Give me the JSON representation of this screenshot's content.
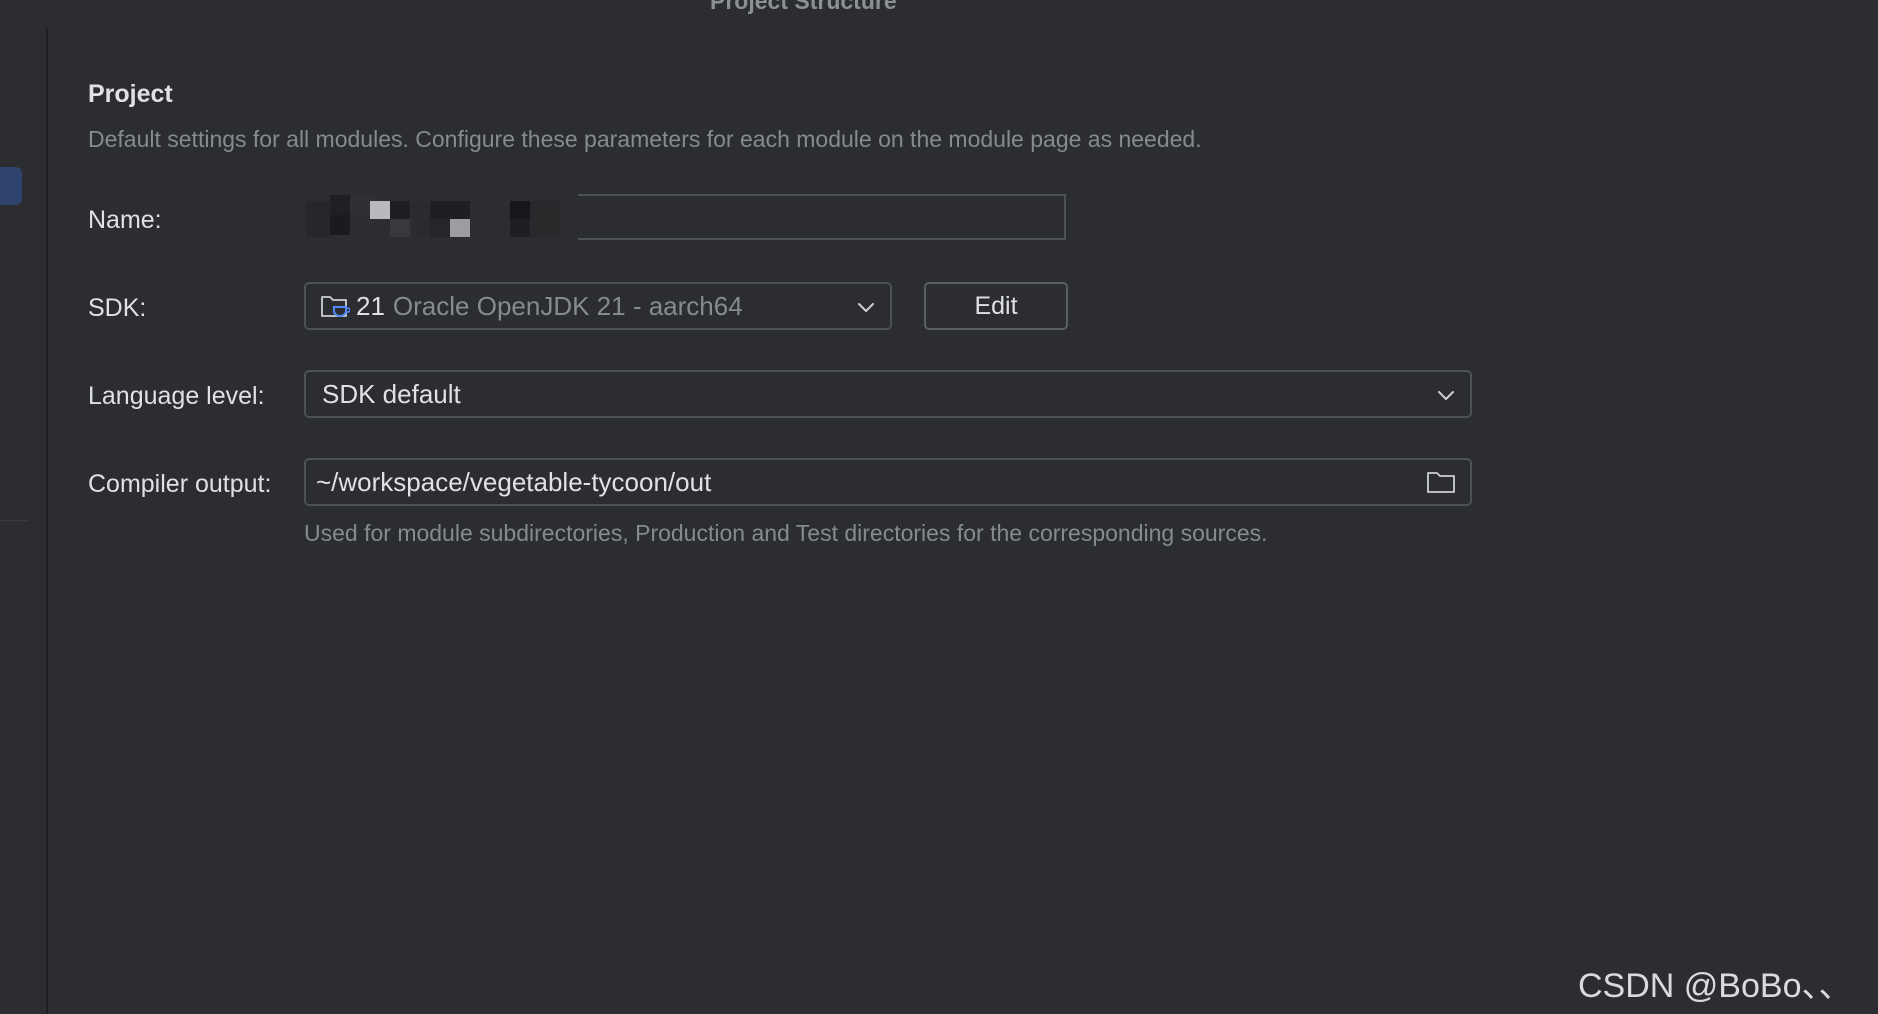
{
  "window": {
    "title": "Project Structure"
  },
  "section": {
    "title": "Project",
    "description": "Default settings for all modules. Configure these parameters for each module on the module page as needed."
  },
  "form": {
    "name": {
      "label": "Name:",
      "value": ""
    },
    "sdk": {
      "label": "SDK:",
      "version": "21",
      "name": "Oracle OpenJDK 21 - aarch64",
      "edit_label": "Edit"
    },
    "language_level": {
      "label": "Language level:",
      "value": "SDK default"
    },
    "compiler_output": {
      "label": "Compiler output:",
      "value": "~/workspace/vegetable-tycoon/out",
      "hint": "Used for module subdirectories, Production and Test directories for the corresponding sources."
    }
  },
  "watermark": {
    "text": "CSDN @BoBo、、"
  },
  "colors": {
    "background": "#2b2d30",
    "text": "#dfe1e5",
    "muted_text": "#868a91",
    "border": "#4e5157",
    "selection": "#2e436e",
    "sdk_icon_accent": "#548af7"
  },
  "icons": {
    "sdk": "jdk-folder-icon",
    "chevron": "chevron-down-icon",
    "folder": "folder-icon"
  }
}
